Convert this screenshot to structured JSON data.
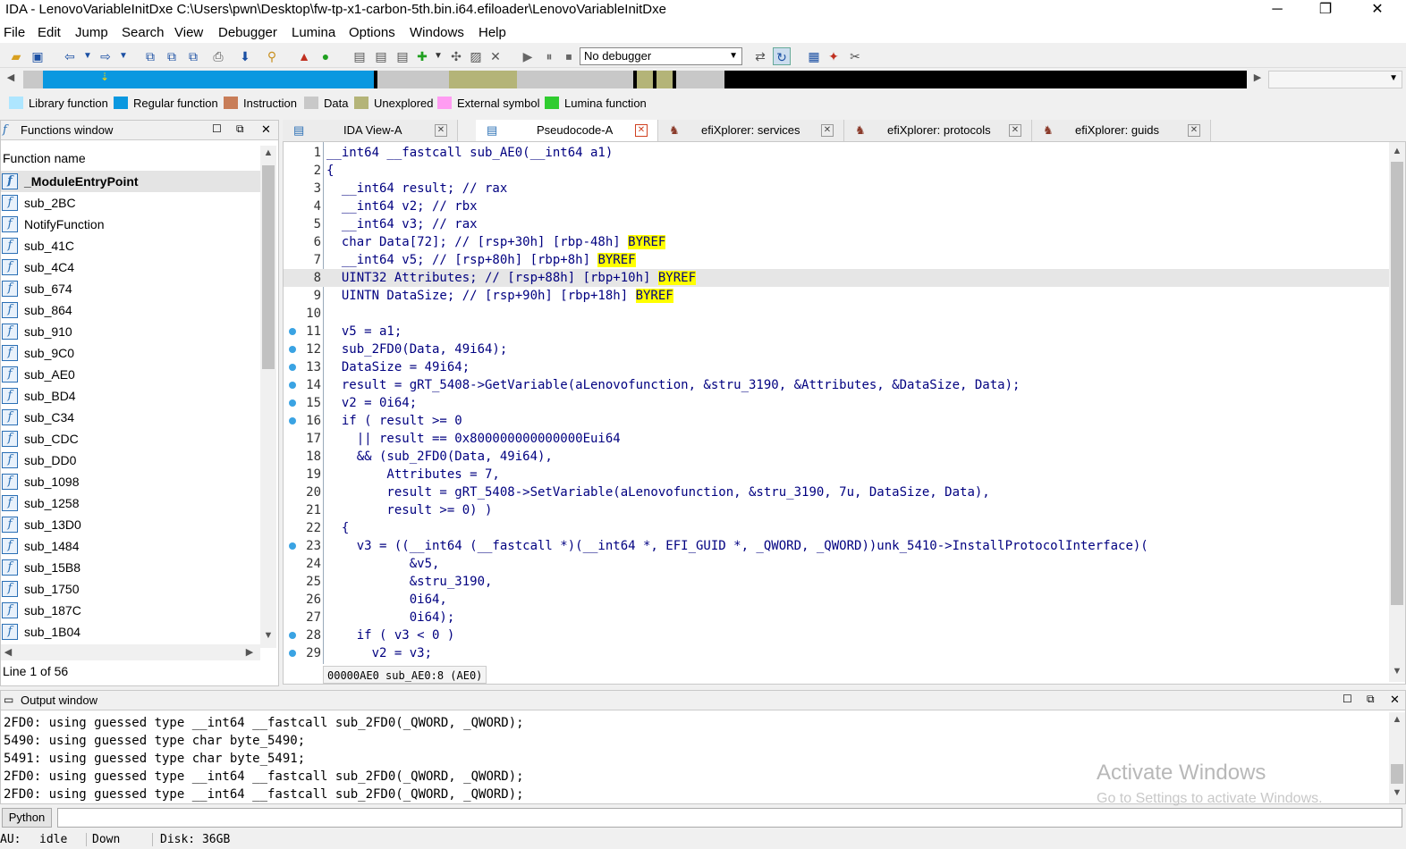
{
  "window": {
    "title": "IDA - LenovoVariableInitDxe C:\\Users\\pwn\\Desktop\\fw-tp-x1-carbon-5th.bin.i64.efiloader\\LenovoVariableInitDxe",
    "minimize": "─",
    "maximize": "❐",
    "close": "✕"
  },
  "menu": [
    "File",
    "Edit",
    "Jump",
    "Search",
    "View",
    "Debugger",
    "Lumina",
    "Options",
    "Windows",
    "Help"
  ],
  "toolbar": {
    "debugger_select": "No debugger"
  },
  "legend": [
    {
      "label": "Library function",
      "color": "#aee6ff"
    },
    {
      "label": "Regular function",
      "color": "#0a98e0"
    },
    {
      "label": "Instruction",
      "color": "#c87d58"
    },
    {
      "label": "Data",
      "color": "#c8c8c8"
    },
    {
      "label": "Unexplored",
      "color": "#b4b478"
    },
    {
      "label": "External symbol",
      "color": "#ff9cf2"
    },
    {
      "label": "Lumina function",
      "color": "#30cc30"
    }
  ],
  "functions_window": {
    "title": "Functions window",
    "column": "Function name",
    "items": [
      "_ModuleEntryPoint",
      "sub_2BC",
      "NotifyFunction",
      "sub_41C",
      "sub_4C4",
      "sub_674",
      "sub_864",
      "sub_910",
      "sub_9C0",
      "sub_AE0",
      "sub_BD4",
      "sub_C34",
      "sub_CDC",
      "sub_DD0",
      "sub_1098",
      "sub_1258",
      "sub_13D0",
      "sub_1484",
      "sub_15B8",
      "sub_1750",
      "sub_187C",
      "sub_1B04"
    ],
    "status": "Line 1 of 56"
  },
  "tabs": [
    {
      "label": "IDA View-A",
      "active": false
    },
    {
      "label": "Pseudocode-A",
      "active": true
    },
    {
      "label": "efiXplorer: services",
      "active": false
    },
    {
      "label": "efiXplorer: protocols",
      "active": false
    },
    {
      "label": "efiXplorer: guids",
      "active": false
    }
  ],
  "code": {
    "lines": [
      {
        "n": "1",
        "t": "__int64 __fastcall sub_AE0(__int64 a1)",
        "dot": false
      },
      {
        "n": "2",
        "t": "{",
        "dot": false
      },
      {
        "n": "3",
        "t": "  __int64 result; // rax",
        "dot": false
      },
      {
        "n": "4",
        "t": "  __int64 v2; // rbx",
        "dot": false
      },
      {
        "n": "5",
        "t": "  __int64 v3; // rax",
        "dot": false
      },
      {
        "n": "6",
        "t": "  char Data[72]; // [rsp+30h] [rbp-48h] BYREF",
        "dot": false
      },
      {
        "n": "7",
        "t": "  __int64 v5; // [rsp+80h] [rbp+8h] BYREF",
        "dot": false
      },
      {
        "n": "8",
        "t": "  UINT32 Attributes; // [rsp+88h] [rbp+10h] BYREF",
        "dot": false,
        "hl": true
      },
      {
        "n": "9",
        "t": "  UINTN DataSize; // [rsp+90h] [rbp+18h] BYREF",
        "dot": false
      },
      {
        "n": "10",
        "t": "",
        "dot": false
      },
      {
        "n": "11",
        "t": "  v5 = a1;",
        "dot": true
      },
      {
        "n": "12",
        "t": "  sub_2FD0(Data, 49i64);",
        "dot": true
      },
      {
        "n": "13",
        "t": "  DataSize = 49i64;",
        "dot": true
      },
      {
        "n": "14",
        "t": "  result = gRT_5408->GetVariable(aLenovofunction, &stru_3190, &Attributes, &DataSize, Data);",
        "dot": true
      },
      {
        "n": "15",
        "t": "  v2 = 0i64;",
        "dot": true
      },
      {
        "n": "16",
        "t": "  if ( result >= 0",
        "dot": true
      },
      {
        "n": "17",
        "t": "    || result == 0x800000000000000Eui64",
        "dot": false
      },
      {
        "n": "18",
        "t": "    && (sub_2FD0(Data, 49i64),",
        "dot": false
      },
      {
        "n": "19",
        "t": "        Attributes = 7,",
        "dot": false
      },
      {
        "n": "20",
        "t": "        result = gRT_5408->SetVariable(aLenovofunction, &stru_3190, 7u, DataSize, Data),",
        "dot": false
      },
      {
        "n": "21",
        "t": "        result >= 0) )",
        "dot": false
      },
      {
        "n": "22",
        "t": "  {",
        "dot": false
      },
      {
        "n": "23",
        "t": "    v3 = ((__int64 (__fastcall *)(__int64 *, EFI_GUID *, _QWORD, _QWORD))unk_5410->InstallProtocolInterface)(",
        "dot": true
      },
      {
        "n": "24",
        "t": "           &v5,",
        "dot": false
      },
      {
        "n": "25",
        "t": "           &stru_3190,",
        "dot": false
      },
      {
        "n": "26",
        "t": "           0i64,",
        "dot": false
      },
      {
        "n": "27",
        "t": "           0i64);",
        "dot": false
      },
      {
        "n": "28",
        "t": "    if ( v3 < 0 )",
        "dot": true
      },
      {
        "n": "29",
        "t": "      v2 = v3;",
        "dot": true
      }
    ],
    "status": "00000AE0 sub_AE0:8 (AE0)"
  },
  "output_window": {
    "title": "Output window",
    "lines": [
      "2FD0: using guessed type __int64 __fastcall sub_2FD0(_QWORD, _QWORD);",
      "5490: using guessed type char byte_5490;",
      "5491: using guessed type char byte_5491;",
      "2FD0: using guessed type __int64 __fastcall sub_2FD0(_QWORD, _QWORD);",
      "2FD0: using guessed type __int64 __fastcall sub_2FD0(_QWORD, _QWORD);"
    ],
    "watermark_title": "Activate Windows",
    "watermark_sub": "Go to Settings to activate Windows."
  },
  "python_button": "Python",
  "statusbar": {
    "au": "AU:",
    "state": "idle",
    "direction": "Down",
    "disk": "Disk: 36GB"
  }
}
